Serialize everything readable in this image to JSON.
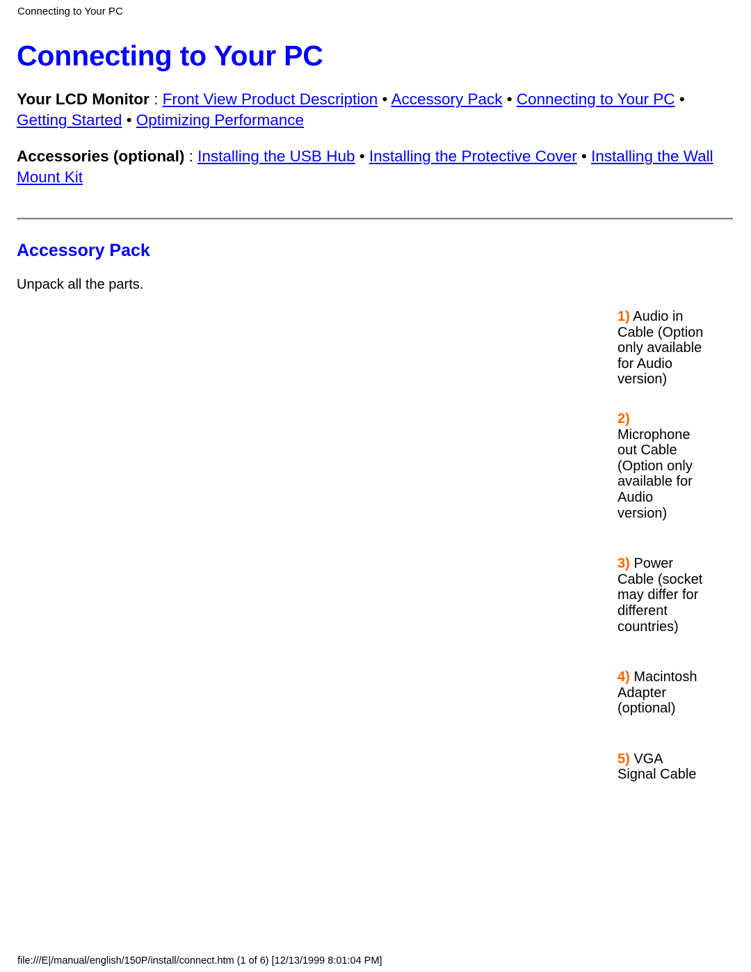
{
  "running_head": "Connecting to Your PC",
  "page_title": "Connecting to Your PC",
  "colors": {
    "heading_blue": "#0000FF",
    "link_blue": "#0000FF",
    "number_orange": "#FF6600",
    "text_black": "#000000",
    "rule_gray": "#808080"
  },
  "nav": {
    "monitor": {
      "lead": "Your LCD Monitor",
      "colon": " : ",
      "links": [
        "Front View Product Description",
        "Accessory Pack",
        "Connecting to Your PC",
        "Getting Started",
        "Optimizing Performance"
      ],
      "separator": " • "
    },
    "accessories": {
      "lead": "Accessories (optional)",
      "colon": " : ",
      "links": [
        "Installing the USB Hub",
        "Installing the Protective Cover",
        "Installing the Wall Mount Kit"
      ],
      "separator": " • "
    }
  },
  "section": {
    "title": "Accessory Pack",
    "body": "Unpack all the parts."
  },
  "parts": [
    {
      "num": "1)",
      "label": " Audio in Cable (Option only available for Audio version)"
    },
    {
      "num": "2)",
      "label": " Microphone out Cable (Option only available for Audio version)"
    },
    {
      "num": "3)",
      "label": " Power Cable (socket may differ for different countries)"
    },
    {
      "num": "4)",
      "label": " Macintosh Adapter (optional)"
    },
    {
      "num": "5)",
      "label": " VGA Signal Cable"
    }
  ],
  "footer": "file:///E|/manual/english/150P/install/connect.htm (1 of 6) [12/13/1999 8:01:04 PM]"
}
